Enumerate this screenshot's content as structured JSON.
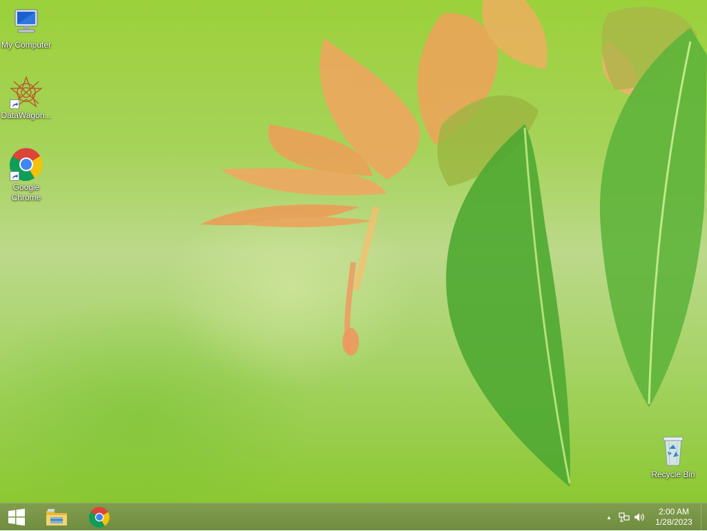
{
  "desktop": {
    "icons": [
      {
        "label": "My Computer",
        "icon": "computer-icon"
      },
      {
        "label": "DataWagon...",
        "icon": "datawagon-icon",
        "shortcut": true
      },
      {
        "label": "Google Chrome",
        "icon": "chrome-icon",
        "shortcut": true
      },
      {
        "label": "Recycle Bin",
        "icon": "recycle-bin-icon"
      }
    ]
  },
  "taskbar": {
    "start": {
      "icon": "windows-logo-icon"
    },
    "pinned": [
      {
        "icon": "file-explorer-icon"
      },
      {
        "icon": "chrome-icon"
      }
    ],
    "tray": {
      "icons": [
        "chevron-up-icon",
        "network-icon",
        "speaker-icon"
      ],
      "chevron": "▲"
    },
    "clock": {
      "time": "2:00 AM",
      "date": "1/28/2023"
    }
  },
  "colors": {
    "wallpaper_green": "#9bd13a",
    "taskbar": "#769440",
    "flower": "#f0a060",
    "leaf": "#4fa832"
  }
}
